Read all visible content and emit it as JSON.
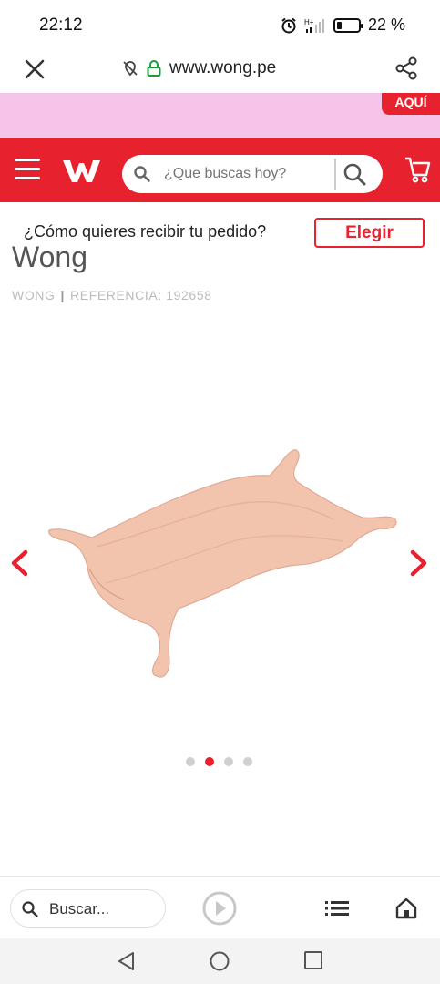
{
  "status": {
    "time": "22:12",
    "battery": "22 %",
    "battery_level": 0.22,
    "icons": [
      "alarm-icon",
      "signal-icon",
      "battery-icon"
    ]
  },
  "browser": {
    "url": "www.wong.pe",
    "icons": [
      "close-icon",
      "location-off-icon",
      "lock-icon",
      "share-icon"
    ]
  },
  "promo": {
    "button_label": "AQUÍ"
  },
  "header": {
    "search_placeholder": "¿Que buscas hoy?",
    "brand_color": "#e8212e",
    "icons": [
      "menu-icon",
      "wong-logo",
      "search-icon",
      "cart-icon"
    ]
  },
  "delivery": {
    "question": "¿Cómo quieres recibir tu pedido?",
    "button_label": "Elegir"
  },
  "product": {
    "brand_title": "Wong",
    "brand": "WONG",
    "reference": "REFERENCIA: 192658",
    "carousel": {
      "total": 4,
      "active_index": 1
    },
    "icons": [
      "chevron-left-icon",
      "chevron-right-icon"
    ]
  },
  "toolbar": {
    "search_label": "Buscar...",
    "icons": [
      "search-icon",
      "play-icon",
      "list-icon",
      "home-icon"
    ]
  },
  "navbar": {
    "icons": [
      "back-icon",
      "home-icon",
      "recents-icon"
    ]
  }
}
